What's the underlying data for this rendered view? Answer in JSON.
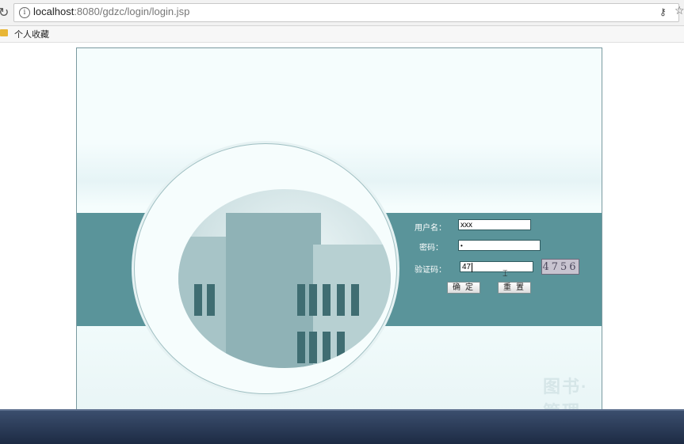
{
  "browser": {
    "url_host": "localhost",
    "url_rest": ":8080/gdzc/login/login.jsp",
    "bookmark_folder": "个人收藏"
  },
  "login": {
    "username_label": "用户名：",
    "password_label": "密码：",
    "captcha_label": "验证码：",
    "username_value": "xxx",
    "password_value": "•",
    "captcha_input_value": "47",
    "captcha_image_text": "4756",
    "confirm_label": "确定",
    "reset_label": "重置"
  },
  "branding": {
    "watermark": "图书·管理"
  },
  "colors": {
    "band": "#5a949a",
    "background": "#f5fdfd"
  }
}
